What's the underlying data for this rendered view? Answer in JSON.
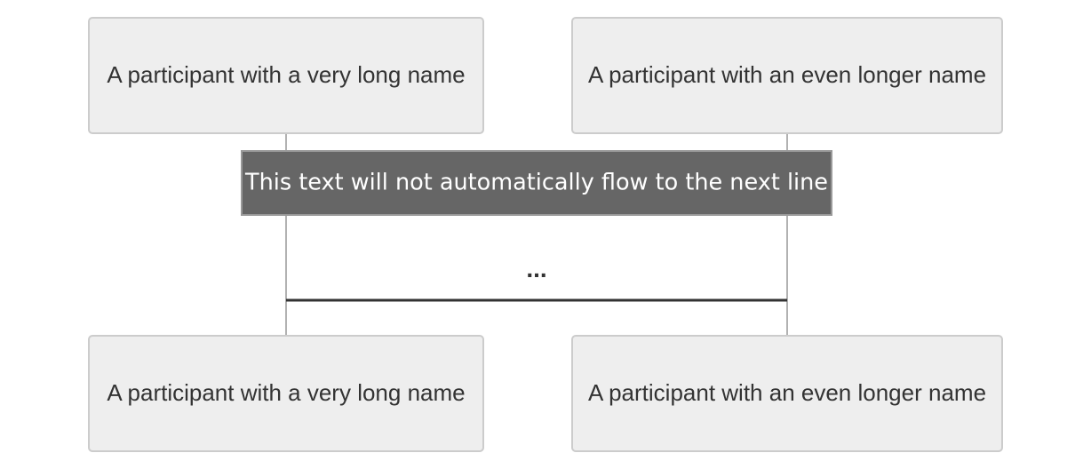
{
  "participants": [
    {
      "name": "A participant with a very long name"
    },
    {
      "name": "A participant with an even longer name"
    }
  ],
  "note": {
    "text": "This text will not automatically flow to the next line"
  },
  "message": {
    "text": "..."
  }
}
